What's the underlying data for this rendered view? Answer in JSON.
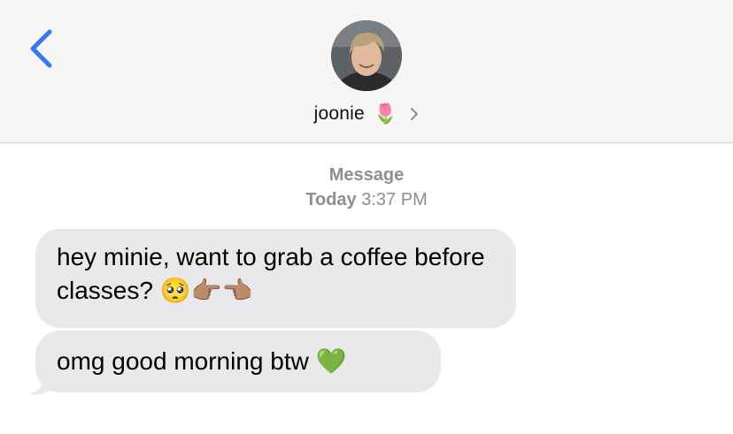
{
  "header": {
    "contact_name": "joonie",
    "contact_emoji": "🌷",
    "back_icon": "chevron-left-icon",
    "details_icon": "chevron-right-icon",
    "accent_color": "#3478f6"
  },
  "thread": {
    "service_label": "Message",
    "day_label": "Today",
    "time_label": "3:37 PM",
    "messages": [
      {
        "text": "hey minie, want to grab a coffee before classes?",
        "emoji": "🥺👉🏽👈🏽",
        "direction": "incoming"
      },
      {
        "text": "omg good morning btw",
        "emoji": "💚",
        "direction": "incoming"
      }
    ],
    "bubble_color": "#e9e9eb"
  }
}
